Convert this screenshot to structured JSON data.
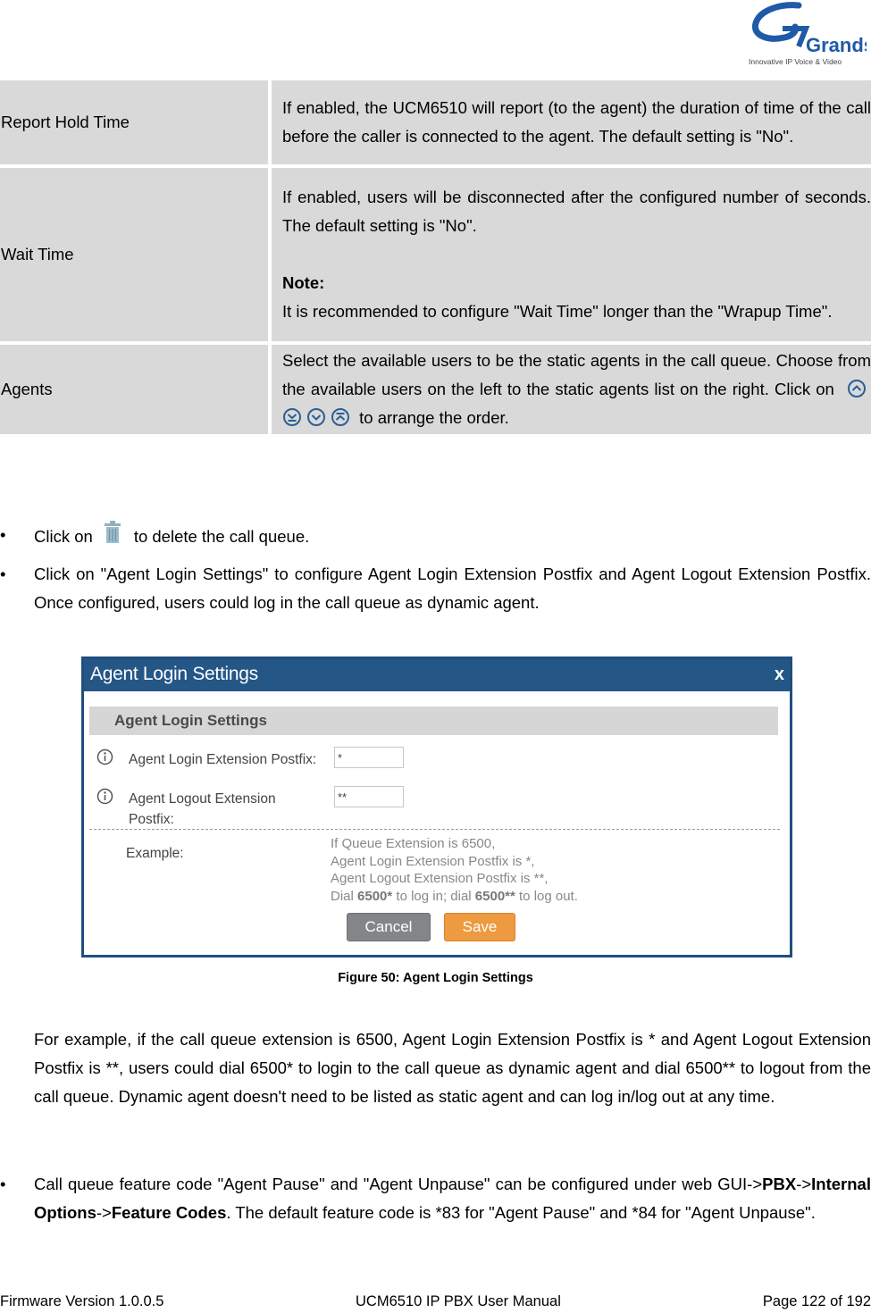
{
  "logo": {
    "brand": "Grandstream",
    "tagline": "Innovative IP Voice & Video"
  },
  "param_table": {
    "rows": [
      {
        "name": "Report Hold Time",
        "description": "If enabled, the UCM6510 will report (to the agent) the duration of time of the call before the caller is connected to the agent. The default setting is \"No\"."
      },
      {
        "name": "Wait Time",
        "description": "If enabled, users will be disconnected after the configured number of seconds. The default setting is \"No\".",
        "note_label": "Note:",
        "note_text": "It is recommended to configure \"Wait Time\" longer than the \"Wrapup Time\"."
      },
      {
        "name": "Agents",
        "description_before": "Select the available users to be the static agents in the call queue. Choose from the available users on the left to the static agents list on the right. Click on",
        "description_after": "to arrange the order.",
        "icons": [
          "move-up-icon",
          "move-bottom-icon",
          "move-down-icon",
          "move-top-icon"
        ]
      }
    ]
  },
  "bullets": [
    {
      "before": "Click on",
      "icon": "trash-icon",
      "after": "to delete the call queue."
    },
    {
      "text": "Click on \"Agent Login Settings\" to configure Agent Login Extension Postfix and Agent Logout Extension Postfix. Once configured, users could log in the call queue as dynamic agent."
    }
  ],
  "dialog": {
    "title": "Agent Login Settings",
    "close_label": "x",
    "section_title": "Agent Login Settings",
    "fields": [
      {
        "label": "Agent Login Extension Postfix:",
        "value": "*"
      },
      {
        "label": "Agent Logout Extension Postfix:",
        "value": "**"
      }
    ],
    "example_label": "Example:",
    "example_lines": [
      "If Queue Extension is 6500,",
      "Agent Login Extension Postfix is *,",
      "Agent Logout Extension Postfix is **,"
    ],
    "example_last": {
      "p1": "Dial ",
      "b1": "6500*",
      "p2": " to log in; dial ",
      "b2": "6500**",
      "p3": " to log out."
    },
    "cancel_label": "Cancel",
    "save_label": "Save",
    "colors": {
      "header": "#245686",
      "save": "#ee9a40",
      "cancel": "#838689"
    }
  },
  "figure_caption": "Figure 50: Agent Login Settings",
  "paragraph": "For example, if the call queue extension is 6500, Agent Login Extension Postfix is * and Agent Logout Extension Postfix is **, users could dial 6500* to login to the call queue as dynamic agent and dial 6500** to logout from the call queue. Dynamic agent doesn't need to be listed as static agent and can log in/log out at any time.",
  "feature_bullet": {
    "p1": "Call queue feature code \"Agent Pause\" and \"Agent Unpause\" can be configured under web GUI->",
    "b1": "PBX",
    "p2": "->",
    "b2": "Internal Options",
    "p3": "->",
    "b3": "Feature Codes",
    "p4": ". The default feature code is *83 for \"Agent Pause\" and *84 for \"Agent Unpause\"."
  },
  "footer": {
    "firmware": "Firmware Version 1.0.0.5",
    "manual": "UCM6510 IP PBX User Manual",
    "page": "Page 122 of 192"
  }
}
